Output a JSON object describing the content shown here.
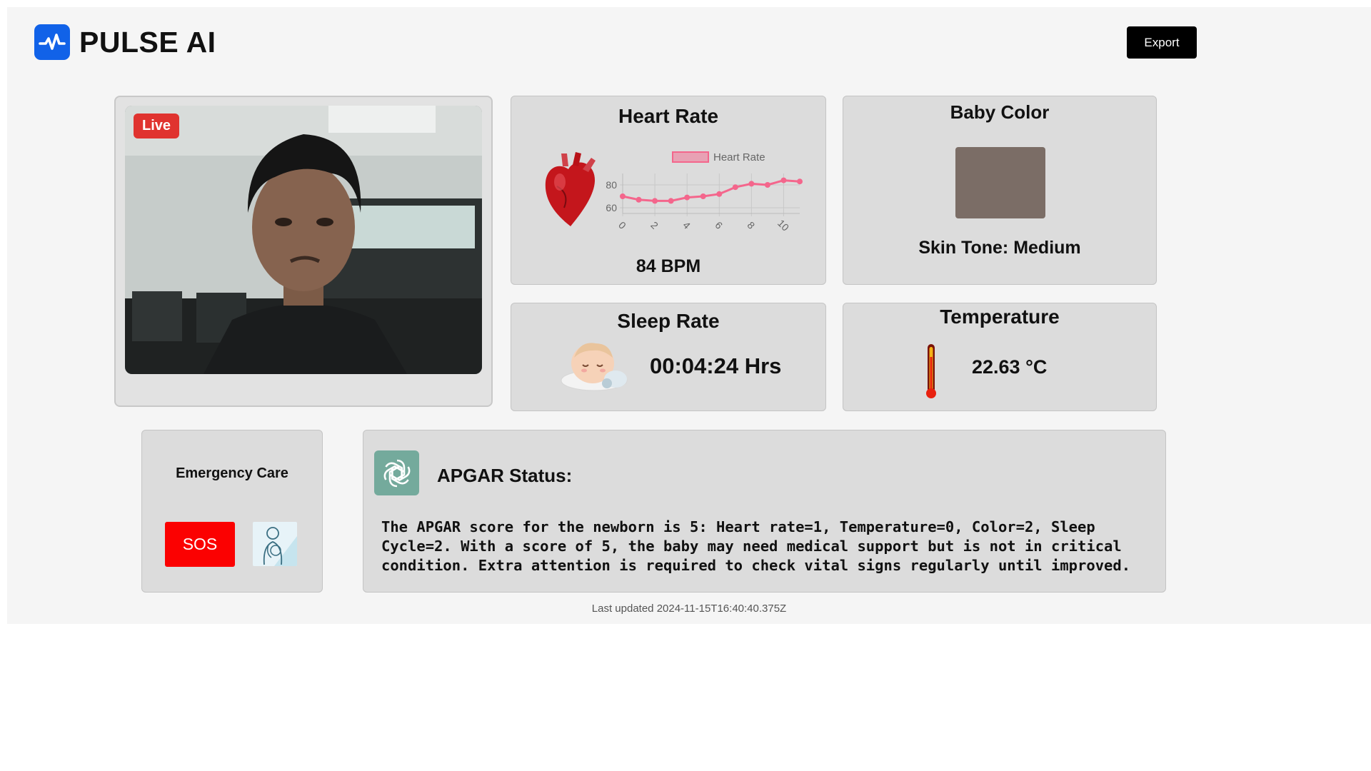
{
  "app": {
    "name": "PULSE AI",
    "export_label": "Export"
  },
  "video": {
    "live_label": "Live"
  },
  "heart_rate": {
    "title": "Heart Rate",
    "value_text": "84 BPM",
    "chart_data": {
      "type": "line",
      "legend": "Heart Rate",
      "x": [
        0,
        1,
        2,
        3,
        4,
        5,
        6,
        7,
        8,
        9,
        10,
        11
      ],
      "values": [
        70,
        67,
        66,
        66,
        69,
        70,
        72,
        78,
        81,
        80,
        84,
        83
      ],
      "xticks": [
        "0",
        "2",
        "4",
        "6",
        "8",
        "10"
      ],
      "yticks": [
        "60",
        "80"
      ],
      "ylim": [
        55,
        90
      ],
      "color": "#f4668c",
      "grid": true
    }
  },
  "baby_color": {
    "title": "Baby Color",
    "swatch_color": "#7b6d66",
    "skin_tone_text": "Skin Tone: Medium"
  },
  "sleep": {
    "title": "Sleep Rate",
    "value_text": "00:04:24 Hrs"
  },
  "temperature": {
    "title": "Temperature",
    "value_text": "22.63 °C"
  },
  "emergency": {
    "title": "Emergency Care",
    "sos_label": "SOS"
  },
  "apgar": {
    "title": "APGAR Status:",
    "text": "The APGAR score for the newborn is 5: Heart rate=1, Temperature=0, Color=2, Sleep Cycle=2. With a score of 5, the baby may need medical support but is not in critical condition. Extra attention is required to check vital signs regularly until improved."
  },
  "footer": {
    "last_updated": "Last updated 2024-11-15T16:40:40.375Z"
  }
}
